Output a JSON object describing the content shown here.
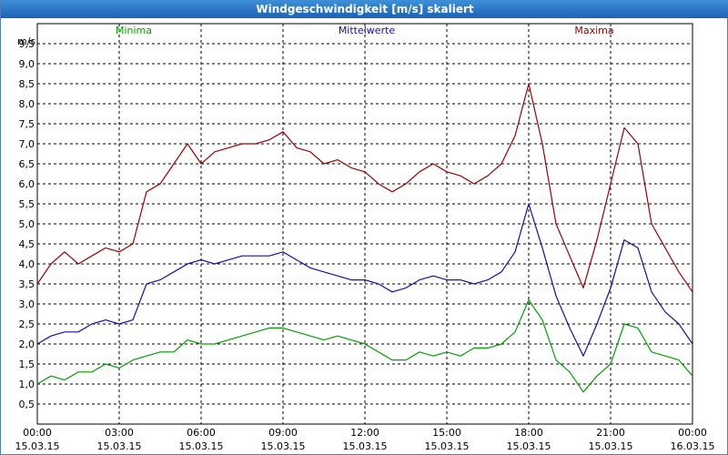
{
  "window": {
    "title": "Windgeschwindigkeit [m/s] skaliert"
  },
  "chart_data": {
    "type": "line",
    "title": "Windgeschwindigkeit [m/s] skaliert",
    "ylabel": "m/s",
    "xlabel": "",
    "ylim": [
      0,
      10
    ],
    "xlim": [
      0,
      24
    ],
    "grid": true,
    "legend_placement": "top",
    "y_ticks": [
      "0,5",
      "1,0",
      "1,5",
      "2,0",
      "2,5",
      "3,0",
      "3,5",
      "4,0",
      "4,5",
      "5,0",
      "5,5",
      "6,0",
      "6,5",
      "7,0",
      "7,5",
      "8,0",
      "8,5",
      "9,0",
      "9,5"
    ],
    "y_tick_values": [
      0.5,
      1.0,
      1.5,
      2.0,
      2.5,
      3.0,
      3.5,
      4.0,
      4.5,
      5.0,
      5.5,
      6.0,
      6.5,
      7.0,
      7.5,
      8.0,
      8.5,
      9.0,
      9.5
    ],
    "x_ticks": [
      {
        "time": "00:00",
        "date": "15.03.15",
        "x": 0
      },
      {
        "time": "03:00",
        "date": "15.03.15",
        "x": 3
      },
      {
        "time": "06:00",
        "date": "15.03.15",
        "x": 6
      },
      {
        "time": "09:00",
        "date": "15.03.15",
        "x": 9
      },
      {
        "time": "12:00",
        "date": "15.03.15",
        "x": 12
      },
      {
        "time": "15:00",
        "date": "15.03.15",
        "x": 15
      },
      {
        "time": "18:00",
        "date": "15.03.15",
        "x": 18
      },
      {
        "time": "21:00",
        "date": "15.03.15",
        "x": 21
      },
      {
        "time": "00:00",
        "date": "16.03.15",
        "x": 24
      }
    ],
    "series": [
      {
        "name": "Minima",
        "color": "#00a000",
        "x": [
          0,
          0.5,
          1,
          1.5,
          2,
          2.5,
          3,
          3.5,
          4,
          4.5,
          5,
          5.5,
          6,
          6.5,
          7,
          7.5,
          8,
          8.5,
          9,
          9.5,
          10,
          10.5,
          11,
          11.5,
          12,
          12.5,
          13,
          13.5,
          14,
          14.5,
          15,
          15.5,
          16,
          16.5,
          17,
          17.5,
          18,
          18.5,
          19,
          19.5,
          20,
          20.5,
          21,
          21.5,
          22,
          22.5,
          23,
          23.5,
          24
        ],
        "values": [
          1.0,
          1.2,
          1.1,
          1.3,
          1.3,
          1.5,
          1.4,
          1.6,
          1.7,
          1.8,
          1.8,
          2.1,
          2.0,
          2.0,
          2.1,
          2.2,
          2.3,
          2.4,
          2.4,
          2.3,
          2.2,
          2.1,
          2.2,
          2.1,
          2.0,
          1.8,
          1.6,
          1.6,
          1.8,
          1.7,
          1.8,
          1.7,
          1.9,
          1.9,
          2.0,
          2.3,
          3.1,
          2.6,
          1.6,
          1.3,
          0.8,
          1.2,
          1.5,
          2.5,
          2.4,
          1.8,
          1.7,
          1.6,
          1.2
        ]
      },
      {
        "name": "Mittelwerte",
        "color": "#1010b0",
        "x": [
          0,
          0.5,
          1,
          1.5,
          2,
          2.5,
          3,
          3.5,
          4,
          4.5,
          5,
          5.5,
          6,
          6.5,
          7,
          7.5,
          8,
          8.5,
          9,
          9.5,
          10,
          10.5,
          11,
          11.5,
          12,
          12.5,
          13,
          13.5,
          14,
          14.5,
          15,
          15.5,
          16,
          16.5,
          17,
          17.5,
          18,
          18.5,
          19,
          19.5,
          20,
          20.5,
          21,
          21.5,
          22,
          22.5,
          23,
          23.5,
          24
        ],
        "values": [
          2.0,
          2.2,
          2.3,
          2.3,
          2.5,
          2.6,
          2.5,
          2.6,
          3.5,
          3.6,
          3.8,
          4.0,
          4.1,
          4.0,
          4.1,
          4.2,
          4.2,
          4.2,
          4.3,
          4.1,
          3.9,
          3.8,
          3.7,
          3.6,
          3.6,
          3.5,
          3.3,
          3.4,
          3.6,
          3.7,
          3.6,
          3.6,
          3.5,
          3.6,
          3.8,
          4.3,
          5.5,
          4.4,
          3.2,
          2.4,
          1.7,
          2.5,
          3.4,
          4.6,
          4.4,
          3.3,
          2.8,
          2.5,
          2.0
        ]
      },
      {
        "name": "Maxima",
        "color": "#a00000",
        "x": [
          0,
          0.5,
          1,
          1.5,
          2,
          2.5,
          3,
          3.5,
          4,
          4.5,
          5,
          5.5,
          6,
          6.5,
          7,
          7.5,
          8,
          8.5,
          9,
          9.5,
          10,
          10.5,
          11,
          11.5,
          12,
          12.5,
          13,
          13.5,
          14,
          14.5,
          15,
          15.5,
          16,
          16.5,
          17,
          17.5,
          18,
          18.5,
          19,
          19.5,
          20,
          20.5,
          21,
          21.5,
          22,
          22.5,
          23,
          23.5,
          24
        ],
        "values": [
          3.5,
          4.0,
          4.3,
          4.0,
          4.2,
          4.4,
          4.3,
          4.5,
          5.8,
          6.0,
          6.5,
          7.0,
          6.5,
          6.8,
          6.9,
          7.0,
          7.0,
          7.1,
          7.3,
          6.9,
          6.8,
          6.5,
          6.6,
          6.4,
          6.3,
          6.0,
          5.8,
          6.0,
          6.3,
          6.5,
          6.3,
          6.2,
          6.0,
          6.2,
          6.5,
          7.2,
          8.5,
          7.0,
          5.0,
          4.2,
          3.4,
          4.6,
          6.0,
          7.4,
          7.0,
          5.0,
          4.4,
          3.8,
          3.3
        ]
      }
    ]
  }
}
